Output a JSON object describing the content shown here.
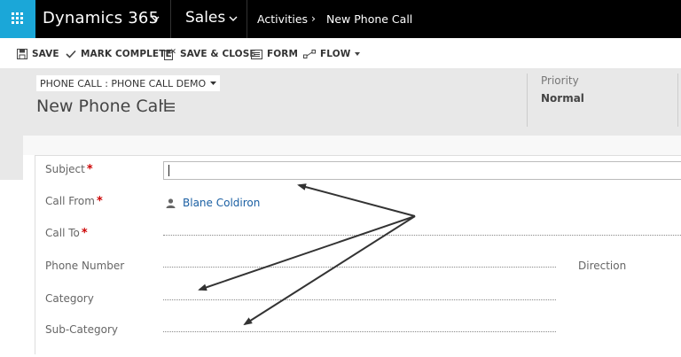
{
  "topnav": {
    "brand": "Dynamics 365",
    "brand_chevron": "⌵",
    "app": "Sales",
    "app_chevron": "⌵",
    "breadcrumb": [
      "Activities",
      "New Phone Call"
    ],
    "breadcrumb_sep": "›"
  },
  "commands": {
    "save": "SAVE",
    "mark_complete": "MARK COMPLETE",
    "save_close": "SAVE & CLOSE",
    "form": "FORM",
    "flow": "FLOW"
  },
  "header": {
    "form_selector": "PHONE CALL : PHONE CALL DEMO",
    "title": "New Phone Call",
    "priority_label": "Priority",
    "priority_value": "Normal"
  },
  "fields": {
    "subject": {
      "label": "Subject",
      "required": "*",
      "value": ""
    },
    "call_from": {
      "label": "Call From",
      "required": "*",
      "value": "Blane Coldiron"
    },
    "call_to": {
      "label": "Call To",
      "required": "*",
      "value": ""
    },
    "phone_number": {
      "label": "Phone Number",
      "value": ""
    },
    "direction": {
      "label": "Direction"
    },
    "category": {
      "label": "Category",
      "value": ""
    },
    "sub_category": {
      "label": "Sub-Category",
      "value": ""
    }
  },
  "colors": {
    "nav_bg": "#000000",
    "waffle_bg": "#1ba7d8",
    "header_bg": "#e8e8e8",
    "link": "#1a5fa3",
    "required": "#cc0000"
  }
}
